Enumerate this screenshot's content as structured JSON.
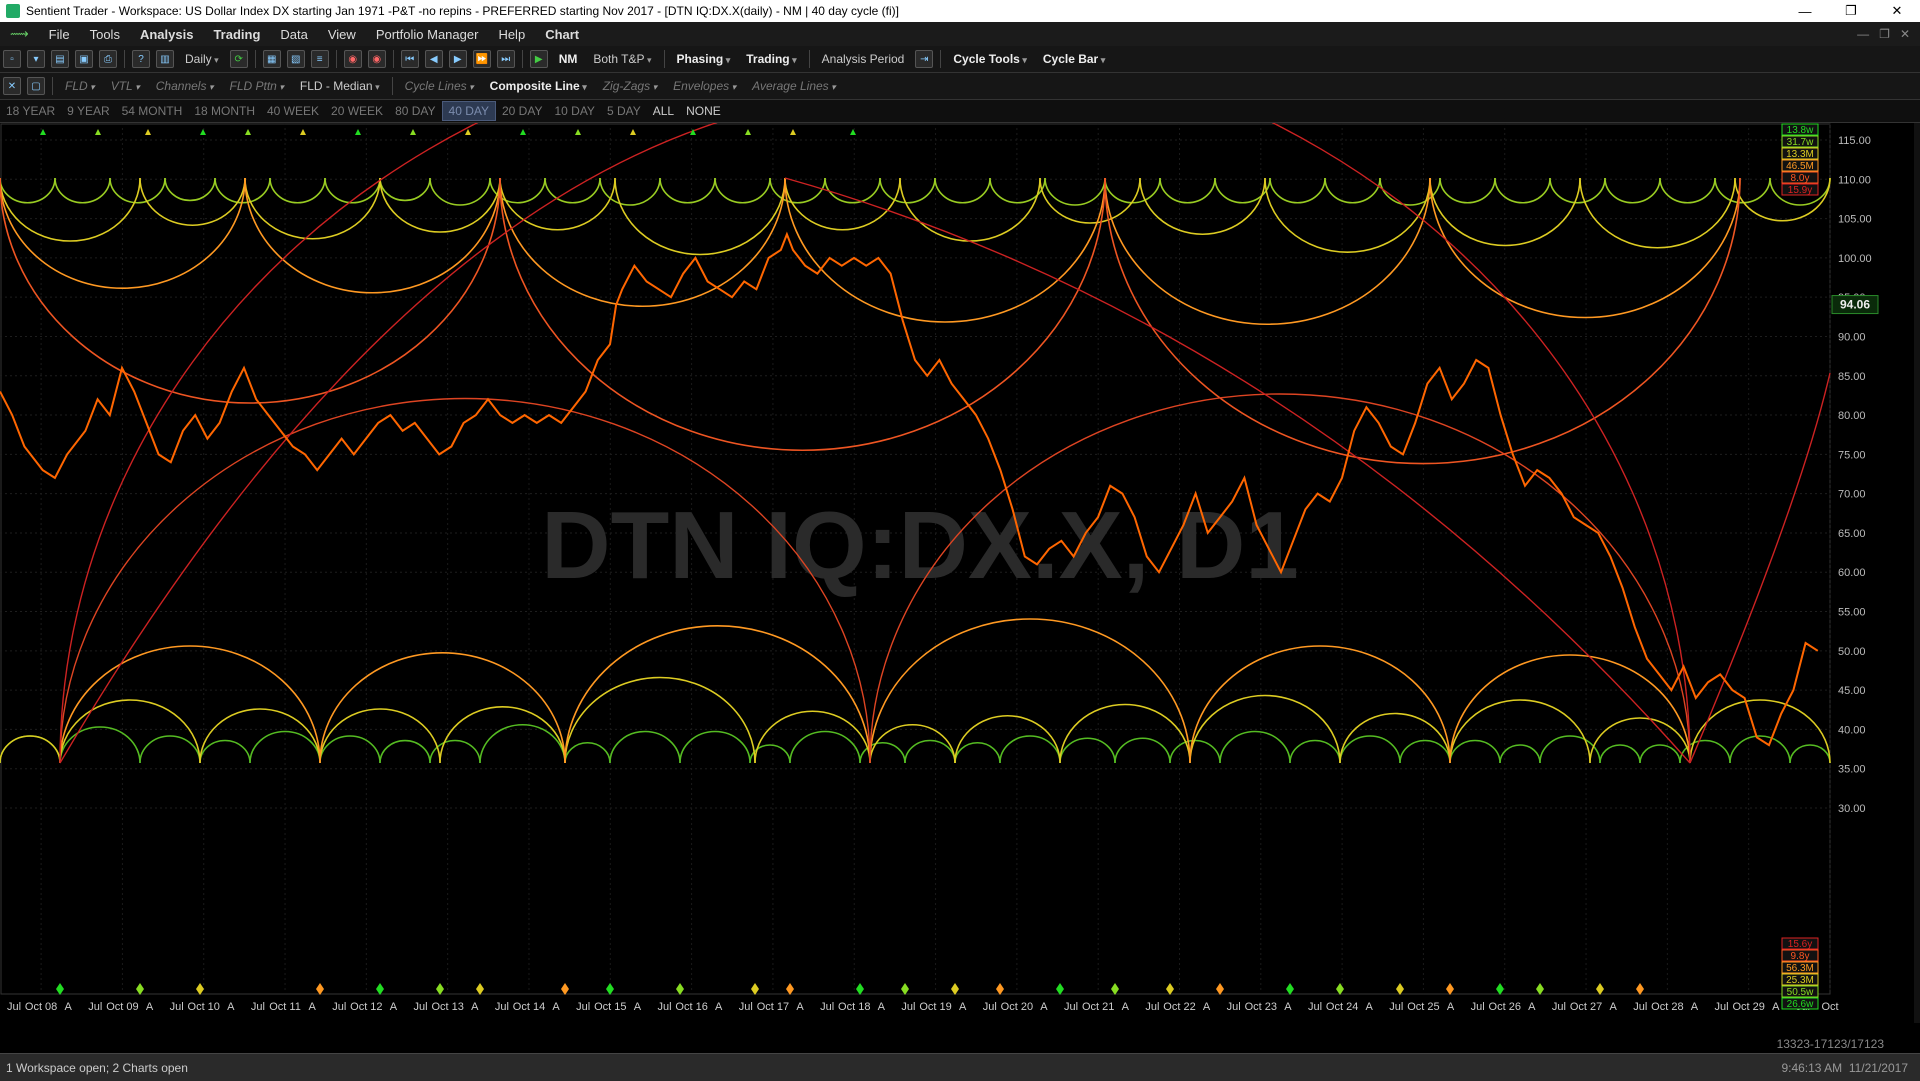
{
  "window": {
    "title": "Sentient Trader - Workspace: US Dollar Index DX starting Jan 1971 -P&T -no repins - PREFERRED starting Nov 2017 - [DTN IQ:DX.X(daily) - NM | 40 day cycle (fi)]",
    "minimize": "—",
    "maximize": "❐",
    "close": "✕"
  },
  "menu": [
    "File",
    "Tools",
    "Analysis",
    "Trading",
    "Data",
    "View",
    "Portfolio Manager",
    "Help",
    "Chart"
  ],
  "menu_bold": [
    "Analysis",
    "Trading",
    "Chart"
  ],
  "menu_right": [
    "—",
    "❐",
    "✕"
  ],
  "toolbar1": {
    "interval": "Daily",
    "nm": "NM",
    "both_tp": "Both T&P",
    "phasing": "Phasing",
    "trading": "Trading",
    "analysis_period": "Analysis Period",
    "cycle_tools": "Cycle Tools",
    "cycle_bar": "Cycle Bar"
  },
  "toolbar2": {
    "fld": "FLD",
    "vtl": "VTL",
    "channels": "Channels",
    "fld_pttn": "FLD Pttn",
    "fld_median": "FLD - Median",
    "cycle_lines": "Cycle Lines",
    "composite_line": "Composite Line",
    "zig_zags": "Zig-Zags",
    "envelopes": "Envelopes",
    "average_lines": "Average Lines"
  },
  "periods": [
    "18 YEAR",
    "9 YEAR",
    "54 MONTH",
    "18 MONTH",
    "40 WEEK",
    "20 WEEK",
    "80 DAY",
    "40 DAY",
    "20 DAY",
    "10 DAY",
    "5 DAY",
    "ALL",
    "NONE"
  ],
  "active_period": "40 DAY",
  "chart_data": {
    "type": "line",
    "watermark": "DTN IQ:DX.X, D1",
    "last_price": "94.06",
    "y_ticks": [
      115,
      110,
      105,
      100,
      95,
      90,
      85,
      80,
      75,
      70,
      65,
      60,
      55,
      50,
      45,
      40,
      35,
      30
    ],
    "y_tick_labels": [
      "115.00",
      "110.00",
      "105.00",
      "100.00",
      "95.00",
      "90.00",
      "85.00",
      "80.00",
      "75.00",
      "70.00",
      "65.00",
      "60.00",
      "55.00",
      "50.00",
      "45.00",
      "40.00",
      "35.00",
      "30.00"
    ],
    "x_labels": [
      "Jul",
      "Oct 08",
      "A",
      "Jul",
      "Oct 09",
      "A",
      "Jul",
      "Oct 10",
      "A",
      "Jul",
      "Oct 11",
      "A",
      "Jul",
      "Oct 12",
      "A",
      "Jul",
      "Oct 13",
      "A",
      "Jul",
      "Oct 14",
      "A",
      "Jul",
      "Oct 15",
      "A",
      "Jul",
      "Oct 16",
      "A",
      "Jul",
      "Oct 17",
      "A",
      "Jul",
      "Oct 18",
      "A",
      "Jul",
      "Oct 19",
      "A",
      "Jul",
      "Oct 20",
      "A",
      "Jul",
      "Oct 21",
      "A",
      "Jul",
      "Oct 22",
      "A",
      "Jul",
      "Oct 23",
      "A",
      "Jul",
      "Oct 24",
      "A",
      "Jul",
      "Oct 25",
      "A",
      "Jul",
      "Oct 26",
      "A",
      "Jul",
      "Oct 27",
      "A",
      "Jul",
      "Oct 28",
      "A",
      "Jul",
      "Oct 29",
      "A",
      "Jul",
      "Oct"
    ],
    "cycle_labels_top": [
      {
        "text": "13.8w",
        "color": "#22dd22"
      },
      {
        "text": "31.7w",
        "color": "#88dd22"
      },
      {
        "text": "13.3M",
        "color": "#ddcc22"
      },
      {
        "text": "46.5M",
        "color": "#ff9922"
      },
      {
        "text": "8.0y",
        "color": "#ff5522"
      },
      {
        "text": "15.9y",
        "color": "#dd2222"
      }
    ],
    "cycle_labels_bottom": [
      {
        "text": "15.6y",
        "color": "#dd2222"
      },
      {
        "text": "9.8y",
        "color": "#ff5522"
      },
      {
        "text": "56.3M",
        "color": "#ff9922"
      },
      {
        "text": "25.3M",
        "color": "#ddcc22"
      },
      {
        "text": "50.5w",
        "color": "#88dd22"
      },
      {
        "text": "26.6w",
        "color": "#22dd22"
      }
    ],
    "price_path": [
      [
        0,
        83
      ],
      [
        10,
        80
      ],
      [
        20,
        76
      ],
      [
        35,
        73
      ],
      [
        45,
        72
      ],
      [
        55,
        75
      ],
      [
        70,
        78
      ],
      [
        80,
        82
      ],
      [
        90,
        80
      ],
      [
        100,
        86
      ],
      [
        110,
        83
      ],
      [
        120,
        79
      ],
      [
        130,
        75
      ],
      [
        140,
        74
      ],
      [
        150,
        78
      ],
      [
        160,
        80
      ],
      [
        170,
        77
      ],
      [
        180,
        79
      ],
      [
        190,
        83
      ],
      [
        200,
        86
      ],
      [
        210,
        82
      ],
      [
        220,
        80
      ],
      [
        230,
        78
      ],
      [
        240,
        76
      ],
      [
        250,
        75
      ],
      [
        260,
        73
      ],
      [
        270,
        75
      ],
      [
        280,
        77
      ],
      [
        290,
        75
      ],
      [
        300,
        77
      ],
      [
        310,
        79
      ],
      [
        320,
        80
      ],
      [
        330,
        78
      ],
      [
        340,
        79
      ],
      [
        350,
        77
      ],
      [
        360,
        75
      ],
      [
        370,
        76
      ],
      [
        380,
        79
      ],
      [
        390,
        80
      ],
      [
        400,
        82
      ],
      [
        410,
        80
      ],
      [
        420,
        79
      ],
      [
        430,
        80
      ],
      [
        440,
        79
      ],
      [
        450,
        80
      ],
      [
        460,
        79
      ],
      [
        470,
        81
      ],
      [
        480,
        83
      ],
      [
        490,
        87
      ],
      [
        500,
        89
      ],
      [
        505,
        94
      ],
      [
        510,
        96
      ],
      [
        520,
        99
      ],
      [
        530,
        97
      ],
      [
        540,
        96
      ],
      [
        550,
        95
      ],
      [
        560,
        98
      ],
      [
        570,
        100
      ],
      [
        580,
        97
      ],
      [
        590,
        96
      ],
      [
        600,
        95
      ],
      [
        610,
        97
      ],
      [
        620,
        96
      ],
      [
        630,
        100
      ],
      [
        640,
        101
      ],
      [
        645,
        103
      ],
      [
        650,
        101
      ],
      [
        660,
        99
      ],
      [
        670,
        98
      ],
      [
        680,
        100
      ],
      [
        690,
        99
      ],
      [
        700,
        100
      ],
      [
        710,
        99
      ],
      [
        720,
        100
      ],
      [
        730,
        98
      ],
      [
        740,
        92
      ],
      [
        750,
        87
      ],
      [
        760,
        85
      ],
      [
        770,
        87
      ],
      [
        780,
        84
      ],
      [
        790,
        82
      ],
      [
        800,
        80
      ],
      [
        810,
        77
      ],
      [
        820,
        73
      ],
      [
        830,
        68
      ],
      [
        840,
        62
      ],
      [
        850,
        61
      ],
      [
        860,
        63
      ],
      [
        870,
        64
      ],
      [
        880,
        62
      ],
      [
        890,
        65
      ],
      [
        900,
        67
      ],
      [
        910,
        71
      ],
      [
        920,
        70
      ],
      [
        930,
        67
      ],
      [
        940,
        62
      ],
      [
        950,
        60
      ],
      [
        960,
        63
      ],
      [
        970,
        66
      ],
      [
        980,
        70
      ],
      [
        990,
        65
      ],
      [
        1000,
        67
      ],
      [
        1010,
        69
      ],
      [
        1020,
        72
      ],
      [
        1030,
        66
      ],
      [
        1040,
        63
      ],
      [
        1050,
        60
      ],
      [
        1060,
        64
      ],
      [
        1070,
        68
      ],
      [
        1080,
        70
      ],
      [
        1090,
        69
      ],
      [
        1100,
        72
      ],
      [
        1110,
        78
      ],
      [
        1120,
        81
      ],
      [
        1130,
        79
      ],
      [
        1140,
        76
      ],
      [
        1150,
        75
      ],
      [
        1160,
        79
      ],
      [
        1170,
        84
      ],
      [
        1180,
        86
      ],
      [
        1190,
        82
      ],
      [
        1200,
        84
      ],
      [
        1210,
        87
      ],
      [
        1220,
        86
      ],
      [
        1230,
        80
      ],
      [
        1240,
        75
      ],
      [
        1250,
        71
      ],
      [
        1260,
        73
      ],
      [
        1270,
        72
      ],
      [
        1280,
        70
      ],
      [
        1290,
        67
      ],
      [
        1300,
        66
      ],
      [
        1310,
        65
      ],
      [
        1320,
        62
      ],
      [
        1330,
        58
      ],
      [
        1340,
        53
      ],
      [
        1350,
        49
      ],
      [
        1360,
        47
      ],
      [
        1370,
        45
      ],
      [
        1380,
        48
      ],
      [
        1390,
        44
      ],
      [
        1400,
        46
      ],
      [
        1410,
        47
      ],
      [
        1420,
        45
      ],
      [
        1430,
        44
      ],
      [
        1440,
        39
      ],
      [
        1450,
        38
      ],
      [
        1460,
        42
      ],
      [
        1470,
        45
      ],
      [
        1480,
        51
      ],
      [
        1490,
        50
      ]
    ]
  },
  "status": {
    "workspace": "1 Workspace open; 2 Charts open",
    "time": "9:46:13 AM",
    "date": "11/21/2017",
    "counter": "13323-17123/17123"
  }
}
